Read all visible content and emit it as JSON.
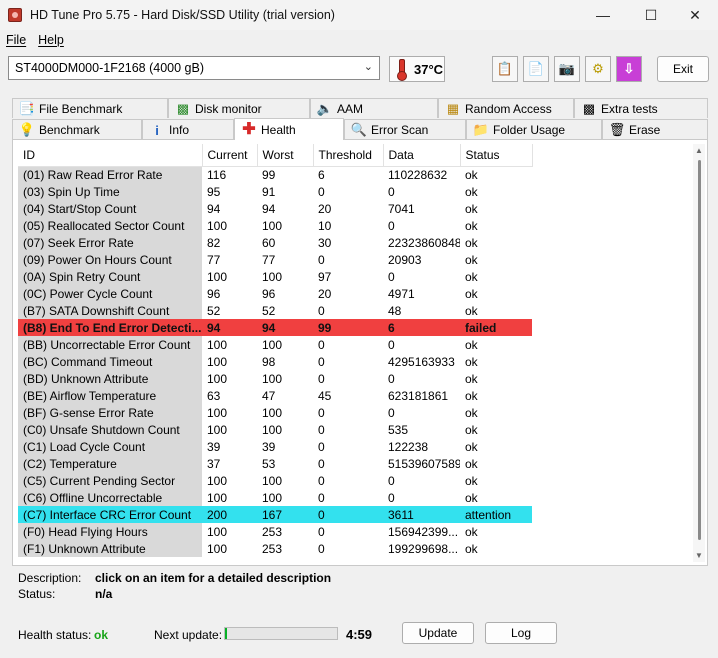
{
  "window": {
    "title": "HD Tune Pro 5.75 - Hard Disk/SSD Utility (trial version)",
    "minimize": "—",
    "maximize": "☐",
    "close": "✕"
  },
  "menu": {
    "file": "File",
    "help": "Help"
  },
  "toolbar": {
    "drive": "ST4000DM000-1F2168 (4000 gB)",
    "temperature": "37°C",
    "exit_label": "Exit"
  },
  "tabs": {
    "row1": [
      "File Benchmark",
      "Disk monitor",
      "AAM",
      "Random Access",
      "Extra tests"
    ],
    "row2": [
      "Benchmark",
      "Info",
      "Health",
      "Error Scan",
      "Folder Usage",
      "Erase"
    ]
  },
  "table": {
    "headers": [
      "ID",
      "Current",
      "Worst",
      "Threshold",
      "Data",
      "Status"
    ],
    "rows": [
      {
        "id": "(01) Raw Read Error Rate",
        "current": "116",
        "worst": "99",
        "threshold": "6",
        "data": "110228632",
        "status": "ok"
      },
      {
        "id": "(03) Spin Up Time",
        "current": "95",
        "worst": "91",
        "threshold": "0",
        "data": "0",
        "status": "ok"
      },
      {
        "id": "(04) Start/Stop Count",
        "current": "94",
        "worst": "94",
        "threshold": "20",
        "data": "7041",
        "status": "ok"
      },
      {
        "id": "(05) Reallocated Sector Count",
        "current": "100",
        "worst": "100",
        "threshold": "10",
        "data": "0",
        "status": "ok"
      },
      {
        "id": "(07) Seek Error Rate",
        "current": "82",
        "worst": "60",
        "threshold": "30",
        "data": "22323860848",
        "status": "ok"
      },
      {
        "id": "(09) Power On Hours Count",
        "current": "77",
        "worst": "77",
        "threshold": "0",
        "data": "20903",
        "status": "ok"
      },
      {
        "id": "(0A) Spin Retry Count",
        "current": "100",
        "worst": "100",
        "threshold": "97",
        "data": "0",
        "status": "ok"
      },
      {
        "id": "(0C) Power Cycle Count",
        "current": "96",
        "worst": "96",
        "threshold": "20",
        "data": "4971",
        "status": "ok"
      },
      {
        "id": "(B7) SATA Downshift Count",
        "current": "52",
        "worst": "52",
        "threshold": "0",
        "data": "48",
        "status": "ok"
      },
      {
        "id": "(B8) End To End Error Detecti...",
        "current": "94",
        "worst": "94",
        "threshold": "99",
        "data": "6",
        "status": "failed"
      },
      {
        "id": "(BB) Uncorrectable Error Count",
        "current": "100",
        "worst": "100",
        "threshold": "0",
        "data": "0",
        "status": "ok"
      },
      {
        "id": "(BC) Command Timeout",
        "current": "100",
        "worst": "98",
        "threshold": "0",
        "data": "4295163933",
        "status": "ok"
      },
      {
        "id": "(BD) Unknown Attribute",
        "current": "100",
        "worst": "100",
        "threshold": "0",
        "data": "0",
        "status": "ok"
      },
      {
        "id": "(BE) Airflow Temperature",
        "current": "63",
        "worst": "47",
        "threshold": "45",
        "data": "623181861",
        "status": "ok"
      },
      {
        "id": "(BF) G-sense Error Rate",
        "current": "100",
        "worst": "100",
        "threshold": "0",
        "data": "0",
        "status": "ok"
      },
      {
        "id": "(C0) Unsafe Shutdown Count",
        "current": "100",
        "worst": "100",
        "threshold": "0",
        "data": "535",
        "status": "ok"
      },
      {
        "id": "(C1) Load Cycle Count",
        "current": "39",
        "worst": "39",
        "threshold": "0",
        "data": "122238",
        "status": "ok"
      },
      {
        "id": "(C2) Temperature",
        "current": "37",
        "worst": "53",
        "threshold": "0",
        "data": "51539607589",
        "status": "ok"
      },
      {
        "id": "(C5) Current Pending Sector",
        "current": "100",
        "worst": "100",
        "threshold": "0",
        "data": "0",
        "status": "ok"
      },
      {
        "id": "(C6) Offline Uncorrectable",
        "current": "100",
        "worst": "100",
        "threshold": "0",
        "data": "0",
        "status": "ok"
      },
      {
        "id": "(C7) Interface CRC Error Count",
        "current": "200",
        "worst": "167",
        "threshold": "0",
        "data": "3611",
        "status": "attention"
      },
      {
        "id": "(F0) Head Flying Hours",
        "current": "100",
        "worst": "253",
        "threshold": "0",
        "data": "156942399...",
        "status": "ok"
      },
      {
        "id": "(F1) Unknown Attribute",
        "current": "100",
        "worst": "253",
        "threshold": "0",
        "data": "199299698...",
        "status": "ok"
      }
    ]
  },
  "details": {
    "description_label": "Description:",
    "description": "click on an item for a detailed description",
    "status_label": "Status:",
    "status": "n/a"
  },
  "footer": {
    "health_label": "Health status:",
    "health_value": "ok",
    "next_label": "Next update:",
    "progress": 0.02,
    "timer": "4:59",
    "update_label": "Update",
    "log_label": "Log"
  },
  "colors": {
    "failed": "#f04040",
    "attention": "#33e1ee",
    "ok_text": "#18a418"
  }
}
